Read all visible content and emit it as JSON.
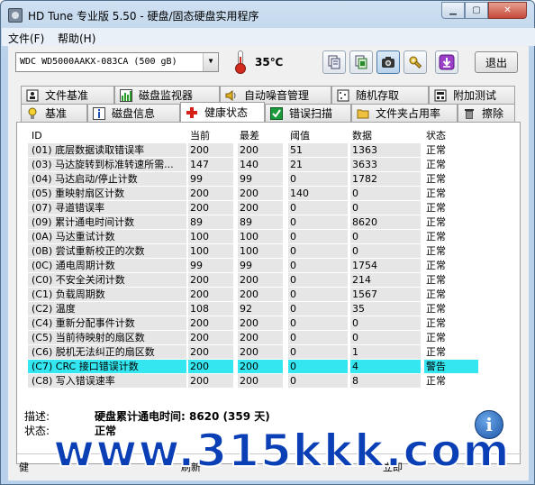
{
  "window": {
    "title": "HD Tune 专业版 5.50 - 硬盘/固态硬盘实用程序"
  },
  "menu": {
    "file": "文件(F)",
    "help": "帮助(H)"
  },
  "toolbar": {
    "drive": "WDC    WD5000AAKX-083CA (500 gB)",
    "temperature": "35℃",
    "exit_label": "退出",
    "buttons": [
      "copy-text-icon",
      "copy-screenshot-icon",
      "camera-icon",
      "settings-tools-icon",
      "download-icon"
    ]
  },
  "tabs_top": [
    {
      "label": "文件基准",
      "icon": "file-benchmark-icon"
    },
    {
      "label": "磁盘监视器",
      "icon": "disk-monitor-icon"
    },
    {
      "label": "自动噪音管理",
      "icon": "speaker-icon"
    },
    {
      "label": "随机存取",
      "icon": "random-access-icon"
    },
    {
      "label": "附加测试",
      "icon": "extra-tests-icon"
    }
  ],
  "tabs_bottom": [
    {
      "label": "基准",
      "icon": "benchmark-icon"
    },
    {
      "label": "磁盘信息",
      "icon": "disk-info-icon"
    },
    {
      "label": "健康状态",
      "icon": "health-cross-icon"
    },
    {
      "label": "错误扫描",
      "icon": "error-scan-icon"
    },
    {
      "label": "文件夹占用率",
      "icon": "folder-icon"
    },
    {
      "label": "擦除",
      "icon": "trash-icon"
    }
  ],
  "table": {
    "headers": {
      "id": "ID",
      "current": "当前",
      "worst": "最差",
      "threshold": "阈值",
      "data": "数据",
      "status": "状态"
    },
    "rows": [
      {
        "id": "(01) 底层数据读取错误率",
        "current": "200",
        "worst": "200",
        "threshold": "51",
        "data": "1363",
        "status": "正常"
      },
      {
        "id": "(03) 马达旋转到标准转速所需...",
        "current": "147",
        "worst": "140",
        "threshold": "21",
        "data": "3633",
        "status": "正常"
      },
      {
        "id": "(04) 马达启动/停止计数",
        "current": "99",
        "worst": "99",
        "threshold": "0",
        "data": "1782",
        "status": "正常"
      },
      {
        "id": "(05) 重映射扇区计数",
        "current": "200",
        "worst": "200",
        "threshold": "140",
        "data": "0",
        "status": "正常"
      },
      {
        "id": "(07) 寻道错误率",
        "current": "200",
        "worst": "200",
        "threshold": "0",
        "data": "0",
        "status": "正常"
      },
      {
        "id": "(09) 累计通电时间计数",
        "current": "89",
        "worst": "89",
        "threshold": "0",
        "data": "8620",
        "status": "正常"
      },
      {
        "id": "(0A) 马达重试计数",
        "current": "100",
        "worst": "100",
        "threshold": "0",
        "data": "0",
        "status": "正常"
      },
      {
        "id": "(0B) 尝试重新校正的次数",
        "current": "100",
        "worst": "100",
        "threshold": "0",
        "data": "0",
        "status": "正常"
      },
      {
        "id": "(0C) 通电周期计数",
        "current": "99",
        "worst": "99",
        "threshold": "0",
        "data": "1754",
        "status": "正常"
      },
      {
        "id": "(C0) 不安全关闭计数",
        "current": "200",
        "worst": "200",
        "threshold": "0",
        "data": "214",
        "status": "正常"
      },
      {
        "id": "(C1) 负载周期数",
        "current": "200",
        "worst": "200",
        "threshold": "0",
        "data": "1567",
        "status": "正常"
      },
      {
        "id": "(C2) 温度",
        "current": "108",
        "worst": "92",
        "threshold": "0",
        "data": "35",
        "status": "正常"
      },
      {
        "id": "(C4) 重新分配事件计数",
        "current": "200",
        "worst": "200",
        "threshold": "0",
        "data": "0",
        "status": "正常"
      },
      {
        "id": "(C5) 当前待映射的扇区数",
        "current": "200",
        "worst": "200",
        "threshold": "0",
        "data": "0",
        "status": "正常"
      },
      {
        "id": "(C6) 脱机无法纠正的扇区数",
        "current": "200",
        "worst": "200",
        "threshold": "0",
        "data": "1",
        "status": "正常"
      },
      {
        "id": "(C7) CRC 接口错误计数",
        "current": "200",
        "worst": "200",
        "threshold": "0",
        "data": "4",
        "status": "警告"
      },
      {
        "id": "(C8) 写入错误速率",
        "current": "200",
        "worst": "200",
        "threshold": "0",
        "data": "8",
        "status": "正常"
      }
    ],
    "highlight_color": "#33e6ef"
  },
  "details": {
    "desc_label": "描述:",
    "desc_value": "硬盘累计通电时间: 8620 (359 天)",
    "status_label": "状态:",
    "status_value": "正常"
  },
  "bottom": {
    "left": "健",
    "refresh": "刷新",
    "now": "立即"
  },
  "watermark": "www.315kkk.com"
}
